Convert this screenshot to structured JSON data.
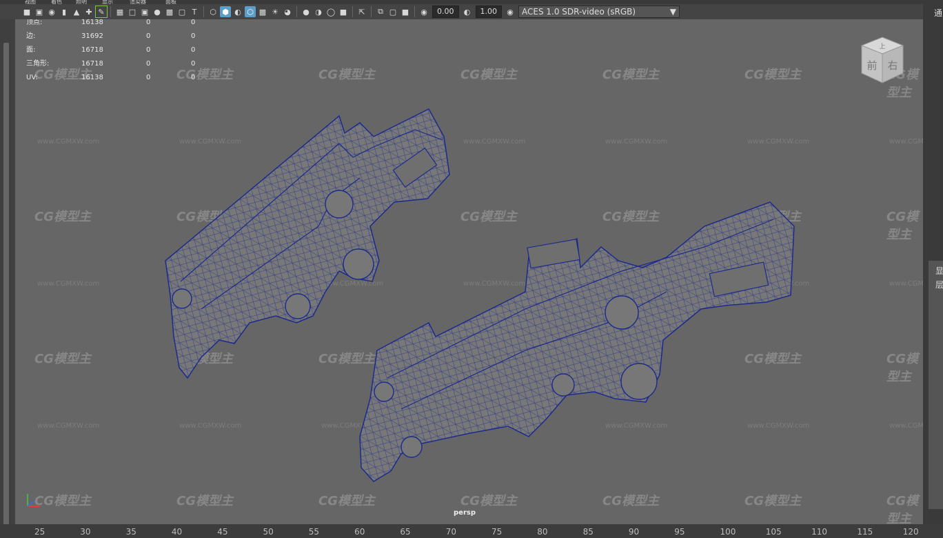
{
  "menu": [
    "视图",
    "着色",
    "照明",
    "显示",
    "渲染器",
    "面板"
  ],
  "toolbar": {
    "field1": "0.00",
    "field2": "1.00",
    "color_management": "ACES 1.0 SDR-video (sRGB)"
  },
  "hud": {
    "rows": [
      {
        "label": "顶点:",
        "v1": "16138",
        "v2": "0",
        "v3": "0"
      },
      {
        "label": "边:",
        "v1": "31692",
        "v2": "0",
        "v3": "0"
      },
      {
        "label": "面:",
        "v1": "16718",
        "v2": "0",
        "v3": "0"
      },
      {
        "label": "三角形:",
        "v1": "16718",
        "v2": "0",
        "v3": "0"
      },
      {
        "label": "UV:",
        "v1": "16138",
        "v2": "0",
        "v3": "0"
      }
    ]
  },
  "viewport": {
    "camera_label": "persp",
    "viewcube": {
      "top": "上",
      "front": "前",
      "right": "右"
    }
  },
  "watermark": {
    "brand": "CG模型主",
    "url": "www.CGMXW.com"
  },
  "right_panel": {
    "label1": "通",
    "label2": "显",
    "label3": "层"
  },
  "timeline": {
    "ticks": [
      "25",
      "30",
      "35",
      "40",
      "45",
      "50",
      "55",
      "60",
      "65",
      "70",
      "75",
      "80",
      "85",
      "90",
      "95",
      "100",
      "105",
      "110",
      "115",
      "120"
    ]
  },
  "colors": {
    "wireframe": "#1c2a8c",
    "viewport_bg": "#666666",
    "active_icon": "#5b9ec9"
  }
}
